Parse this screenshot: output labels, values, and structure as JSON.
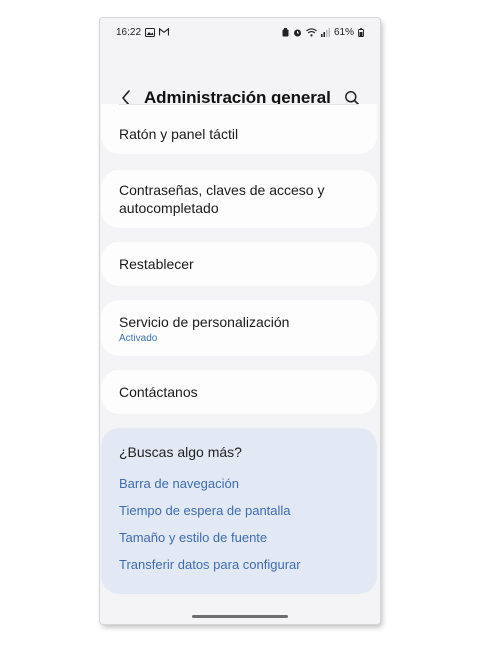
{
  "status_bar": {
    "time": "16:22",
    "battery": "61%",
    "left_icons": [
      "gallery-icon",
      "gmail-icon"
    ],
    "right_icons": [
      "battery-saver-icon",
      "alarm-icon",
      "wifi-icon",
      "signal-icon",
      "battery-icon"
    ]
  },
  "header": {
    "title": "Administración general",
    "back_icon": "chevron-left-icon",
    "search_icon": "search-icon"
  },
  "items": [
    {
      "title": "Ratón y panel táctil"
    },
    {
      "title": "Contraseñas, claves de acceso y autocompletado"
    },
    {
      "title": "Restablecer"
    },
    {
      "title": "Servicio de personalización",
      "subtitle": "Activado"
    },
    {
      "title": "Contáctanos"
    }
  ],
  "more": {
    "title": "¿Buscas algo más?",
    "links": [
      "Barra de navegación",
      "Tiempo de espera de pantalla",
      "Tamaño y estilo de fuente",
      "Transferir datos para configurar"
    ]
  },
  "colors": {
    "accent_link": "#3d6bb3",
    "panel_background": "#e3e9f4",
    "screen_background": "#f4f4f6"
  }
}
